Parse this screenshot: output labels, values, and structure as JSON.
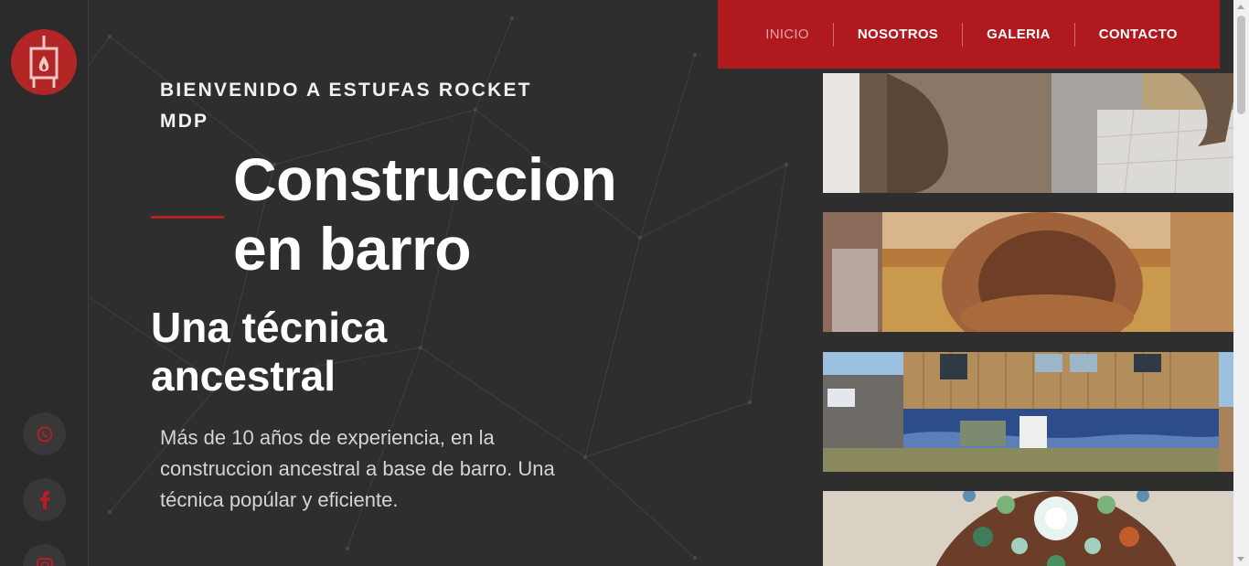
{
  "brand": {
    "logo_icon": "stove-icon",
    "accent": "#b0191d"
  },
  "nav": {
    "items": [
      {
        "label": "INICIO",
        "active": true
      },
      {
        "label": "NOSOTROS",
        "active": false
      },
      {
        "label": "GALERIA",
        "active": false
      },
      {
        "label": "CONTACTO",
        "active": false
      }
    ]
  },
  "hero": {
    "welcome": "BIENVENIDO A ESTUFAS ROCKET MDP",
    "title": "Construccion en barro",
    "subtitle": "Una técnica ancestral",
    "description": "Más de 10 años de experiencia, en la construccion ancestral a base de barro. Una técnica popúlar y eficiente."
  },
  "social": {
    "whatsapp_icon": "whatsapp-icon",
    "facebook_icon": "facebook-icon",
    "instagram_icon": "instagram-icon"
  },
  "gallery": {
    "images": [
      "clay-stove-construction-photo",
      "clay-oven-building-photo",
      "wooden-house-mural-photo",
      "bottle-mosaic-wall-photo"
    ]
  }
}
